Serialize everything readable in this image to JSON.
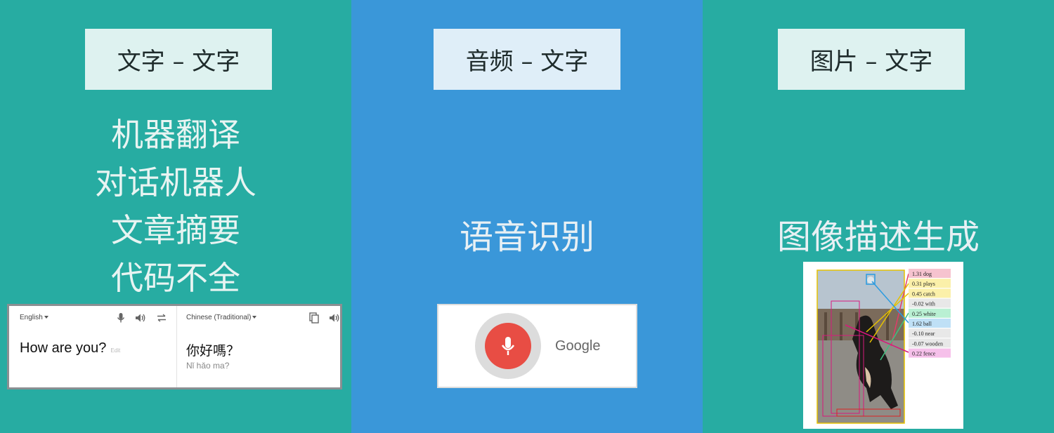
{
  "columns": {
    "left": {
      "label": "文字 – 文字",
      "tasks": [
        "机器翻译",
        "对话机器人",
        "文章摘要",
        "代码不全"
      ]
    },
    "middle": {
      "label": "音频 – 文字",
      "title": "语音识别"
    },
    "right": {
      "label": "图片 – 文字",
      "title": "图像描述生成"
    }
  },
  "translate_widget": {
    "source_lang": "English",
    "target_lang": "Chinese (Traditional)",
    "source_text": "How are you?",
    "edit_label": "Edit",
    "output_text": "你好嗎？",
    "romanization": "Nǐ hǎo ma?"
  },
  "voice_widget": {
    "brand": "Google"
  },
  "caption_image": {
    "words": [
      {
        "text": "1.31 dog",
        "color": "#f6c3cf"
      },
      {
        "text": "0.31 plays",
        "color": "#fbf0a9"
      },
      {
        "text": "0.45 catch",
        "color": "#fbf0a9"
      },
      {
        "text": "-0.02 with",
        "color": "#e8e8e8"
      },
      {
        "text": "0.25 white",
        "color": "#b9f0d3"
      },
      {
        "text": "1.62 ball",
        "color": "#bfe0f6"
      },
      {
        "text": "-0.10 near",
        "color": "#e8e8e8"
      },
      {
        "text": "-0.07 wooden",
        "color": "#e8e8e8"
      },
      {
        "text": "0.22 fence",
        "color": "#f6c0ea"
      }
    ]
  },
  "colors": {
    "teal": "#27aca2",
    "blue": "#3a97d9",
    "mic_red": "#e84d44"
  }
}
